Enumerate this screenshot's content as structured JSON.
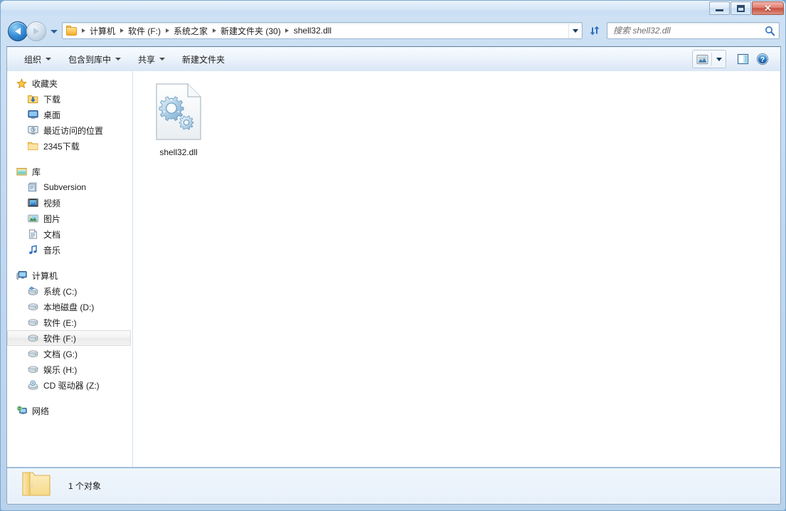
{
  "window": {
    "title": "",
    "controls": {
      "minimize": "最小化",
      "maximize": "向下还原",
      "close": "关闭",
      "close_glyph": "✕"
    }
  },
  "navigation": {
    "back_label": "后退",
    "forward_label": "前进",
    "history_label": "最近浏览的位置",
    "refresh_label": "刷新",
    "address_dropdown_label": "以前的位置"
  },
  "breadcrumb": {
    "folder_icon": "folder-icon",
    "items": [
      {
        "label": "计算机"
      },
      {
        "label": "软件 (F:)"
      },
      {
        "label": "系统之家"
      },
      {
        "label": "新建文件夹 (30)"
      },
      {
        "label": "shell32.dll"
      }
    ]
  },
  "search": {
    "placeholder": "搜索 shell32.dll",
    "value": "",
    "icon": "search-icon"
  },
  "toolbar": {
    "items": [
      {
        "label": "组织",
        "has_menu": true
      },
      {
        "label": "包含到库中",
        "has_menu": true
      },
      {
        "label": "共享",
        "has_menu": true
      },
      {
        "label": "新建文件夹",
        "has_menu": false
      }
    ],
    "view_button": "更改您的视图",
    "view_dropdown": "更多选项",
    "preview_pane": "显示预览窗格",
    "help": "获取帮助"
  },
  "sidebar": {
    "groups": [
      {
        "root": {
          "label": "收藏夹",
          "icon": "star-icon"
        },
        "children": [
          {
            "label": "下载",
            "icon": "downloads-folder-icon"
          },
          {
            "label": "桌面",
            "icon": "desktop-icon"
          },
          {
            "label": "最近访问的位置",
            "icon": "recent-places-icon"
          },
          {
            "label": "2345下载",
            "icon": "folder-icon"
          }
        ]
      },
      {
        "root": {
          "label": "库",
          "icon": "library-icon"
        },
        "children": [
          {
            "label": "Subversion",
            "icon": "subversion-icon"
          },
          {
            "label": "视频",
            "icon": "video-icon"
          },
          {
            "label": "图片",
            "icon": "pictures-icon"
          },
          {
            "label": "文档",
            "icon": "documents-icon"
          },
          {
            "label": "音乐",
            "icon": "music-icon"
          }
        ]
      },
      {
        "root": {
          "label": "计算机",
          "icon": "computer-icon"
        },
        "children": [
          {
            "label": "系统 (C:)",
            "icon": "system-drive-icon",
            "selected": false
          },
          {
            "label": "本地磁盘 (D:)",
            "icon": "drive-icon",
            "selected": false
          },
          {
            "label": "软件 (E:)",
            "icon": "drive-icon",
            "selected": false
          },
          {
            "label": "软件 (F:)",
            "icon": "drive-icon",
            "selected": true
          },
          {
            "label": "文档 (G:)",
            "icon": "drive-icon",
            "selected": false
          },
          {
            "label": "娱乐 (H:)",
            "icon": "drive-icon",
            "selected": false
          },
          {
            "label": "CD 驱动器 (Z:)",
            "icon": "cd-drive-icon",
            "selected": false
          }
        ]
      },
      {
        "root": {
          "label": "网络",
          "icon": "network-icon"
        },
        "children": []
      }
    ]
  },
  "content": {
    "files": [
      {
        "name": "shell32.dll",
        "icon": "dll-file-icon"
      }
    ]
  },
  "statusbar": {
    "icon": "folder-icon",
    "text": "1 个对象"
  },
  "colors": {
    "accent": "#2e5f96",
    "selection": "#eaeaea",
    "close_button": "#c94f3c",
    "frame": "#b9d2ec"
  }
}
